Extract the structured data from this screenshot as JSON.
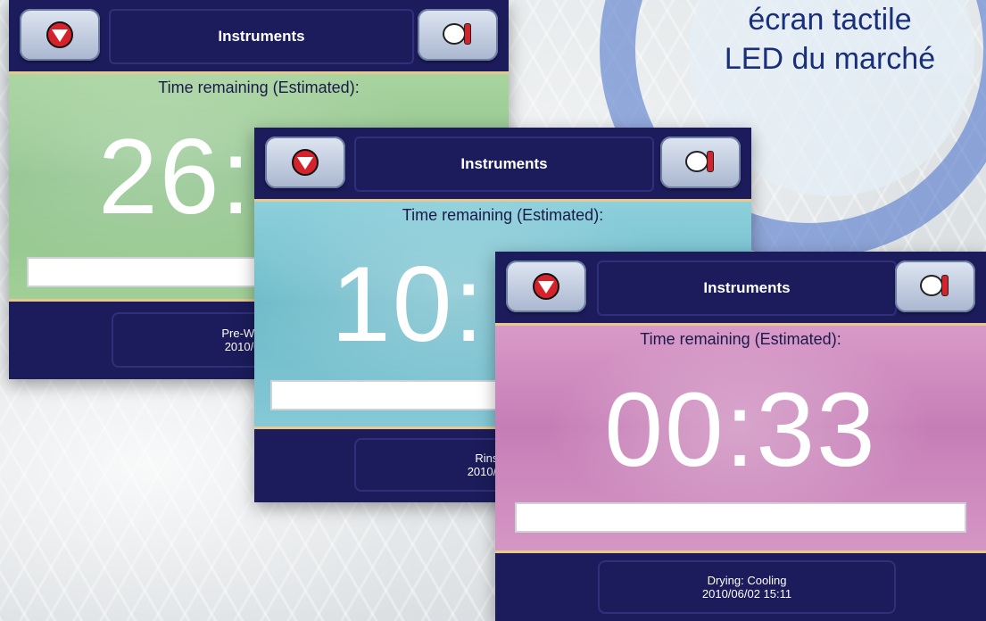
{
  "headline": {
    "line1": "écran tactile",
    "line2": "LED du marché"
  },
  "screens": [
    {
      "title": "Instruments",
      "time_label": "Time remaining (Estimated):",
      "time_value": "26:",
      "progress_fraction": 0.02,
      "status_line1": "Pre-Wash",
      "status_line2": "2010/06/",
      "theme_color": "#a9d4a0"
    },
    {
      "title": "Instruments",
      "time_label": "Time remaining (Estimated):",
      "time_value": "10:",
      "progress_fraction": 0.0,
      "status_line1": "Rinse",
      "status_line2": "2010/06/",
      "theme_color": "#8ed0dc"
    },
    {
      "title": "Instruments",
      "time_label": "Time remaining (Estimated):",
      "time_value": "00:33",
      "progress_fraction": 1.0,
      "status_line1": "Drying: Cooling",
      "status_line2": "2010/06/02   15:11",
      "theme_color": "#d89ac8"
    }
  ],
  "icons": {
    "left_button": "stop-down-icon",
    "right_button": "thermometer-gauge-icon"
  },
  "colors": {
    "frame": "#1c1c5c",
    "accent_line": "#e7c98d",
    "ring": "#466ec8"
  }
}
